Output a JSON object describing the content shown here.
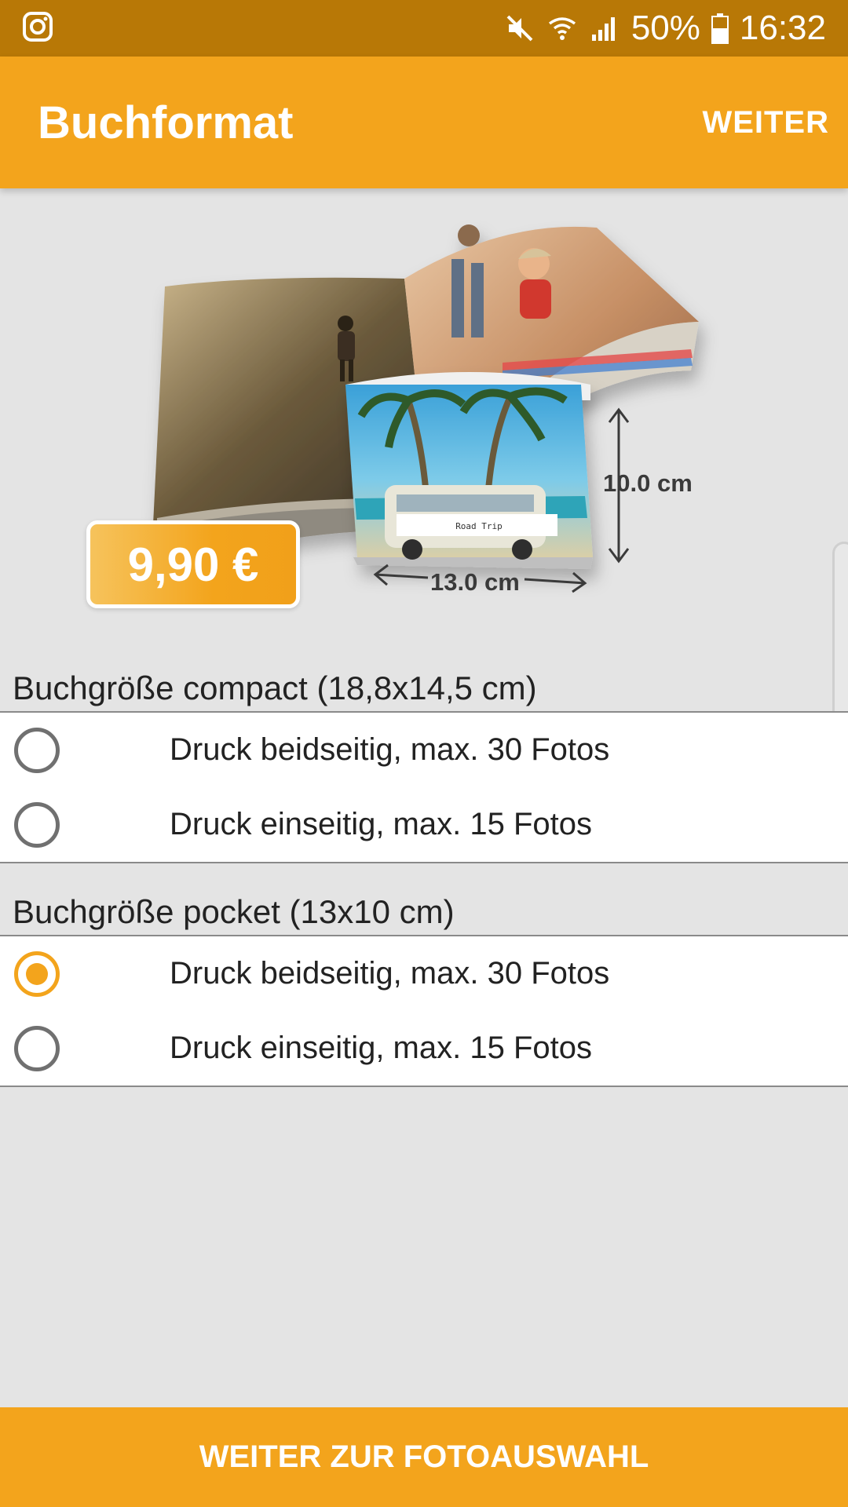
{
  "status_bar": {
    "battery": "50%",
    "time": "16:32",
    "icons": [
      "instagram-icon",
      "mute-icon",
      "wifi-icon",
      "signal-icon",
      "battery-icon"
    ]
  },
  "app_bar": {
    "title": "Buchformat",
    "action": "WEITER"
  },
  "hero": {
    "price": "9,90 €",
    "width_label": "13.0 cm",
    "height_label": "10.0 cm",
    "cover_text": "Road Trip"
  },
  "sections": [
    {
      "title": "Buchgröße compact (18,8x14,5 cm)",
      "options": [
        {
          "label": "Druck beidseitig, max. 30 Fotos",
          "selected": false
        },
        {
          "label": "Druck einseitig, max. 15 Fotos",
          "selected": false
        }
      ]
    },
    {
      "title": "Buchgröße pocket (13x10 cm)",
      "options": [
        {
          "label": "Druck beidseitig, max. 30 Fotos",
          "selected": true
        },
        {
          "label": "Druck einseitig, max. 15 Fotos",
          "selected": false
        }
      ]
    }
  ],
  "bottom_button": "WEITER ZUR FOTOAUSWAHL",
  "colors": {
    "accent": "#f3a41c",
    "status_bar": "#b87806",
    "background": "#e4e4e4"
  }
}
